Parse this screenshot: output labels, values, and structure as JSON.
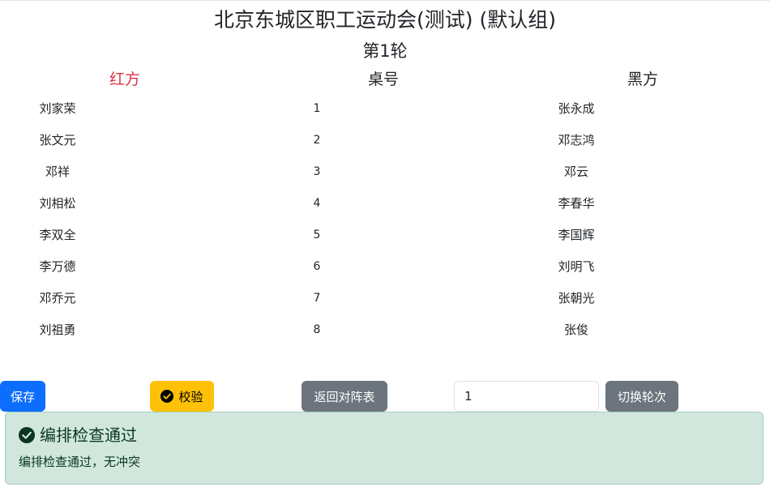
{
  "header": {
    "title": "北京东城区职工运动会(测试) (默认组)",
    "round": "第1轮"
  },
  "columns": {
    "red": "红方",
    "table": "桌号",
    "black": "黑方"
  },
  "pairings": [
    {
      "red": "刘家荣",
      "table": "1",
      "black": "张永成"
    },
    {
      "red": "张文元",
      "table": "2",
      "black": "邓志鸿"
    },
    {
      "red": "邓祥",
      "table": "3",
      "black": "邓云"
    },
    {
      "red": "刘相松",
      "table": "4",
      "black": "李春华"
    },
    {
      "red": "李双全",
      "table": "5",
      "black": "李国辉"
    },
    {
      "red": "李万德",
      "table": "6",
      "black": "刘明飞"
    },
    {
      "red": "邓乔元",
      "table": "7",
      "black": "张朝光"
    },
    {
      "red": "刘祖勇",
      "table": "8",
      "black": "张俊"
    }
  ],
  "toolbar": {
    "save_label": "保存",
    "check_label": "校验",
    "check_icon": "check-circle-icon",
    "back_label": "返回对阵表",
    "round_value": "1",
    "switch_label": "切换轮次"
  },
  "alert": {
    "icon": "check-circle-icon",
    "title": "编排检查通过",
    "message": "编排检查通过，无冲突"
  },
  "colors": {
    "red_side": "#dc3545",
    "primary": "#0d6efd",
    "warning": "#ffc107",
    "secondary": "#6c757d",
    "success_bg": "#d1e7dd"
  }
}
